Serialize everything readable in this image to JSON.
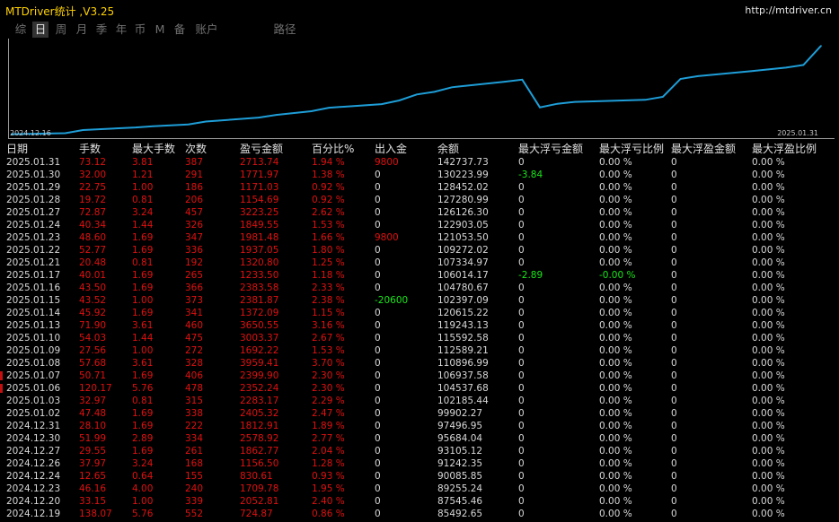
{
  "app": {
    "title": "MTDriver统计 ,V3.25",
    "site": "http://mtdriver.cn"
  },
  "tabs": [
    {
      "label": "综",
      "active": false
    },
    {
      "label": "日",
      "active": true
    },
    {
      "label": "周",
      "active": false
    },
    {
      "label": "月",
      "active": false
    },
    {
      "label": "季",
      "active": false
    },
    {
      "label": "年",
      "active": false
    },
    {
      "label": "币",
      "active": false
    },
    {
      "label": "M",
      "active": false
    },
    {
      "label": "备",
      "active": false
    },
    {
      "label": "账户",
      "active": false
    },
    {
      "label": "路径",
      "active": false
    }
  ],
  "colors": {
    "line": "#1e9ed8",
    "loss_value": "#e01010",
    "positive_value": "#19e619",
    "active_tab_bg": "#333333"
  },
  "chart_data": {
    "type": "line",
    "x_start_label": "2024.12.16",
    "x_end_label": "2025.01.31",
    "x": [
      "2024.12.19",
      "2024.12.20",
      "2024.12.23",
      "2024.12.24",
      "2024.12.26",
      "2024.12.27",
      "2024.12.30",
      "2024.12.31",
      "2025.01.02",
      "2025.01.03",
      "2025.01.06",
      "2025.01.07",
      "2025.01.08",
      "2025.01.09",
      "2025.01.10",
      "2025.01.13",
      "2025.01.14",
      "2025.01.15",
      "2025.01.16",
      "2025.01.17",
      "2025.01.21",
      "2025.01.22",
      "2025.01.23",
      "2025.01.24",
      "2025.01.27",
      "2025.01.28",
      "2025.01.29",
      "2025.01.30",
      "2025.01.31"
    ],
    "series": [
      {
        "values": [
          85492.65,
          87545.46,
          89255.24,
          90085.85,
          91242.35,
          93105.12,
          95684.04,
          97496.95,
          99902.27,
          102185.44,
          104537.68,
          106937.58,
          110896.99,
          112589.21,
          115592.58,
          119243.13,
          120615.22,
          102397.09,
          104780.67,
          106014.17,
          107334.97,
          109272.02,
          121053.5,
          122903.05,
          126126.3,
          127280.99,
          128452.02,
          130223.99,
          142737.73
        ]
      }
    ]
  },
  "table": {
    "headers": [
      "日期",
      "手数",
      "最大手数",
      "次数",
      "盈亏金额",
      "百分比%",
      "出入金",
      "余额",
      "最大浮亏金额",
      "最大浮亏比例",
      "最大浮盈金额",
      "最大浮盈比例"
    ],
    "rows": [
      [
        "2025.01.31",
        "73.12",
        "3.81",
        "387",
        "2713.74",
        "1.94 %",
        "9800",
        "142737.73",
        "0",
        "0.00 %",
        "0",
        "0.00 %"
      ],
      [
        "2025.01.30",
        "32.00",
        "1.21",
        "291",
        "1771.97",
        "1.38 %",
        "0",
        "130223.99",
        "-3.84",
        "0.00 %",
        "0",
        "0.00 %"
      ],
      [
        "2025.01.29",
        "22.75",
        "1.00",
        "186",
        "1171.03",
        "0.92 %",
        "0",
        "128452.02",
        "0",
        "0.00 %",
        "0",
        "0.00 %"
      ],
      [
        "2025.01.28",
        "19.72",
        "0.81",
        "206",
        "1154.69",
        "0.92 %",
        "0",
        "127280.99",
        "0",
        "0.00 %",
        "0",
        "0.00 %"
      ],
      [
        "2025.01.27",
        "72.87",
        "3.24",
        "457",
        "3223.25",
        "2.62 %",
        "0",
        "126126.30",
        "0",
        "0.00 %",
        "0",
        "0.00 %"
      ],
      [
        "2025.01.24",
        "40.34",
        "1.44",
        "326",
        "1849.55",
        "1.53 %",
        "0",
        "122903.05",
        "0",
        "0.00 %",
        "0",
        "0.00 %"
      ],
      [
        "2025.01.23",
        "48.60",
        "1.69",
        "347",
        "1981.48",
        "1.66 %",
        "9800",
        "121053.50",
        "0",
        "0.00 %",
        "0",
        "0.00 %"
      ],
      [
        "2025.01.22",
        "52.77",
        "1.69",
        "336",
        "1937.05",
        "1.80 %",
        "0",
        "109272.02",
        "0",
        "0.00 %",
        "0",
        "0.00 %"
      ],
      [
        "2025.01.21",
        "20.48",
        "0.81",
        "192",
        "1320.80",
        "1.25 %",
        "0",
        "107334.97",
        "0",
        "0.00 %",
        "0",
        "0.00 %"
      ],
      [
        "2025.01.17",
        "40.01",
        "1.69",
        "265",
        "1233.50",
        "1.18 %",
        "0",
        "106014.17",
        "-2.89",
        "-0.00 %",
        "0",
        "0.00 %"
      ],
      [
        "2025.01.16",
        "43.50",
        "1.69",
        "366",
        "2383.58",
        "2.33 %",
        "0",
        "104780.67",
        "0",
        "0.00 %",
        "0",
        "0.00 %"
      ],
      [
        "2025.01.15",
        "43.52",
        "1.00",
        "373",
        "2381.87",
        "2.38 %",
        "-20600",
        "102397.09",
        "0",
        "0.00 %",
        "0",
        "0.00 %"
      ],
      [
        "2025.01.14",
        "45.92",
        "1.69",
        "341",
        "1372.09",
        "1.15 %",
        "0",
        "120615.22",
        "0",
        "0.00 %",
        "0",
        "0.00 %"
      ],
      [
        "2025.01.13",
        "71.90",
        "3.61",
        "460",
        "3650.55",
        "3.16 %",
        "0",
        "119243.13",
        "0",
        "0.00 %",
        "0",
        "0.00 %"
      ],
      [
        "2025.01.10",
        "54.03",
        "1.44",
        "475",
        "3003.37",
        "2.67 %",
        "0",
        "115592.58",
        "0",
        "0.00 %",
        "0",
        "0.00 %"
      ],
      [
        "2025.01.09",
        "27.56",
        "1.00",
        "272",
        "1692.22",
        "1.53 %",
        "0",
        "112589.21",
        "0",
        "0.00 %",
        "0",
        "0.00 %"
      ],
      [
        "2025.01.08",
        "57.68",
        "3.61",
        "328",
        "3959.41",
        "3.70 %",
        "0",
        "110896.99",
        "0",
        "0.00 %",
        "0",
        "0.00 %"
      ],
      [
        "2025.01.07",
        "50.71",
        "1.69",
        "406",
        "2399.90",
        "2.30 %",
        "0",
        "106937.58",
        "0",
        "0.00 %",
        "0",
        "0.00 %"
      ],
      [
        "2025.01.06",
        "120.17",
        "5.76",
        "478",
        "2352.24",
        "2.30 %",
        "0",
        "104537.68",
        "0",
        "0.00 %",
        "0",
        "0.00 %"
      ],
      [
        "2025.01.03",
        "32.97",
        "0.81",
        "315",
        "2283.17",
        "2.29 %",
        "0",
        "102185.44",
        "0",
        "0.00 %",
        "0",
        "0.00 %"
      ],
      [
        "2025.01.02",
        "47.48",
        "1.69",
        "338",
        "2405.32",
        "2.47 %",
        "0",
        "99902.27",
        "0",
        "0.00 %",
        "0",
        "0.00 %"
      ],
      [
        "2024.12.31",
        "28.10",
        "1.69",
        "222",
        "1812.91",
        "1.89 %",
        "0",
        "97496.95",
        "0",
        "0.00 %",
        "0",
        "0.00 %"
      ],
      [
        "2024.12.30",
        "51.99",
        "2.89",
        "334",
        "2578.92",
        "2.77 %",
        "0",
        "95684.04",
        "0",
        "0.00 %",
        "0",
        "0.00 %"
      ],
      [
        "2024.12.27",
        "29.55",
        "1.69",
        "261",
        "1862.77",
        "2.04 %",
        "0",
        "93105.12",
        "0",
        "0.00 %",
        "0",
        "0.00 %"
      ],
      [
        "2024.12.26",
        "37.97",
        "3.24",
        "168",
        "1156.50",
        "1.28 %",
        "0",
        "91242.35",
        "0",
        "0.00 %",
        "0",
        "0.00 %"
      ],
      [
        "2024.12.24",
        "12.65",
        "0.64",
        "155",
        "830.61",
        "0.93 %",
        "0",
        "90085.85",
        "0",
        "0.00 %",
        "0",
        "0.00 %"
      ],
      [
        "2024.12.23",
        "46.16",
        "4.00",
        "240",
        "1709.78",
        "1.95 %",
        "0",
        "89255.24",
        "0",
        "0.00 %",
        "0",
        "0.00 %"
      ],
      [
        "2024.12.20",
        "33.15",
        "1.00",
        "339",
        "2052.81",
        "2.40 %",
        "0",
        "87545.46",
        "0",
        "0.00 %",
        "0",
        "0.00 %"
      ],
      [
        "2024.12.19",
        "138.07",
        "5.76",
        "552",
        "724.87",
        "0.86 %",
        "0",
        "85492.65",
        "0",
        "0.00 %",
        "0",
        "0.00 %"
      ]
    ]
  }
}
